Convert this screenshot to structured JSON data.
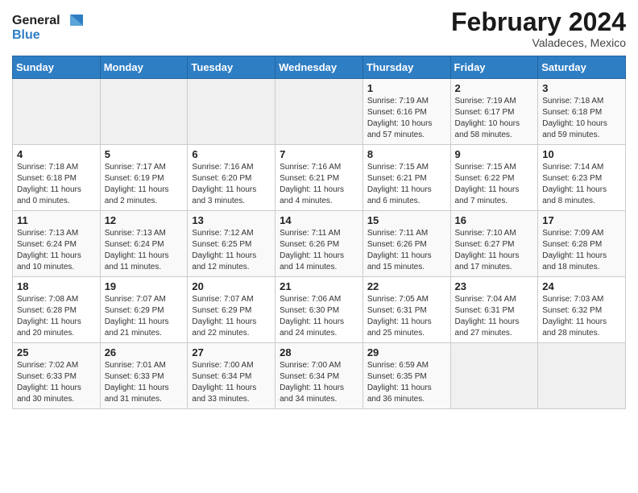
{
  "header": {
    "logo_line1": "General",
    "logo_line2": "Blue",
    "month_title": "February 2024",
    "location": "Valadeces, Mexico"
  },
  "weekdays": [
    "Sunday",
    "Monday",
    "Tuesday",
    "Wednesday",
    "Thursday",
    "Friday",
    "Saturday"
  ],
  "weeks": [
    [
      {
        "day": "",
        "info": ""
      },
      {
        "day": "",
        "info": ""
      },
      {
        "day": "",
        "info": ""
      },
      {
        "day": "",
        "info": ""
      },
      {
        "day": "1",
        "info": "Sunrise: 7:19 AM\nSunset: 6:16 PM\nDaylight: 10 hours\nand 57 minutes."
      },
      {
        "day": "2",
        "info": "Sunrise: 7:19 AM\nSunset: 6:17 PM\nDaylight: 10 hours\nand 58 minutes."
      },
      {
        "day": "3",
        "info": "Sunrise: 7:18 AM\nSunset: 6:18 PM\nDaylight: 10 hours\nand 59 minutes."
      }
    ],
    [
      {
        "day": "4",
        "info": "Sunrise: 7:18 AM\nSunset: 6:18 PM\nDaylight: 11 hours\nand 0 minutes."
      },
      {
        "day": "5",
        "info": "Sunrise: 7:17 AM\nSunset: 6:19 PM\nDaylight: 11 hours\nand 2 minutes."
      },
      {
        "day": "6",
        "info": "Sunrise: 7:16 AM\nSunset: 6:20 PM\nDaylight: 11 hours\nand 3 minutes."
      },
      {
        "day": "7",
        "info": "Sunrise: 7:16 AM\nSunset: 6:21 PM\nDaylight: 11 hours\nand 4 minutes."
      },
      {
        "day": "8",
        "info": "Sunrise: 7:15 AM\nSunset: 6:21 PM\nDaylight: 11 hours\nand 6 minutes."
      },
      {
        "day": "9",
        "info": "Sunrise: 7:15 AM\nSunset: 6:22 PM\nDaylight: 11 hours\nand 7 minutes."
      },
      {
        "day": "10",
        "info": "Sunrise: 7:14 AM\nSunset: 6:23 PM\nDaylight: 11 hours\nand 8 minutes."
      }
    ],
    [
      {
        "day": "11",
        "info": "Sunrise: 7:13 AM\nSunset: 6:24 PM\nDaylight: 11 hours\nand 10 minutes."
      },
      {
        "day": "12",
        "info": "Sunrise: 7:13 AM\nSunset: 6:24 PM\nDaylight: 11 hours\nand 11 minutes."
      },
      {
        "day": "13",
        "info": "Sunrise: 7:12 AM\nSunset: 6:25 PM\nDaylight: 11 hours\nand 12 minutes."
      },
      {
        "day": "14",
        "info": "Sunrise: 7:11 AM\nSunset: 6:26 PM\nDaylight: 11 hours\nand 14 minutes."
      },
      {
        "day": "15",
        "info": "Sunrise: 7:11 AM\nSunset: 6:26 PM\nDaylight: 11 hours\nand 15 minutes."
      },
      {
        "day": "16",
        "info": "Sunrise: 7:10 AM\nSunset: 6:27 PM\nDaylight: 11 hours\nand 17 minutes."
      },
      {
        "day": "17",
        "info": "Sunrise: 7:09 AM\nSunset: 6:28 PM\nDaylight: 11 hours\nand 18 minutes."
      }
    ],
    [
      {
        "day": "18",
        "info": "Sunrise: 7:08 AM\nSunset: 6:28 PM\nDaylight: 11 hours\nand 20 minutes."
      },
      {
        "day": "19",
        "info": "Sunrise: 7:07 AM\nSunset: 6:29 PM\nDaylight: 11 hours\nand 21 minutes."
      },
      {
        "day": "20",
        "info": "Sunrise: 7:07 AM\nSunset: 6:29 PM\nDaylight: 11 hours\nand 22 minutes."
      },
      {
        "day": "21",
        "info": "Sunrise: 7:06 AM\nSunset: 6:30 PM\nDaylight: 11 hours\nand 24 minutes."
      },
      {
        "day": "22",
        "info": "Sunrise: 7:05 AM\nSunset: 6:31 PM\nDaylight: 11 hours\nand 25 minutes."
      },
      {
        "day": "23",
        "info": "Sunrise: 7:04 AM\nSunset: 6:31 PM\nDaylight: 11 hours\nand 27 minutes."
      },
      {
        "day": "24",
        "info": "Sunrise: 7:03 AM\nSunset: 6:32 PM\nDaylight: 11 hours\nand 28 minutes."
      }
    ],
    [
      {
        "day": "25",
        "info": "Sunrise: 7:02 AM\nSunset: 6:33 PM\nDaylight: 11 hours\nand 30 minutes."
      },
      {
        "day": "26",
        "info": "Sunrise: 7:01 AM\nSunset: 6:33 PM\nDaylight: 11 hours\nand 31 minutes."
      },
      {
        "day": "27",
        "info": "Sunrise: 7:00 AM\nSunset: 6:34 PM\nDaylight: 11 hours\nand 33 minutes."
      },
      {
        "day": "28",
        "info": "Sunrise: 7:00 AM\nSunset: 6:34 PM\nDaylight: 11 hours\nand 34 minutes."
      },
      {
        "day": "29",
        "info": "Sunrise: 6:59 AM\nSunset: 6:35 PM\nDaylight: 11 hours\nand 36 minutes."
      },
      {
        "day": "",
        "info": ""
      },
      {
        "day": "",
        "info": ""
      }
    ]
  ]
}
